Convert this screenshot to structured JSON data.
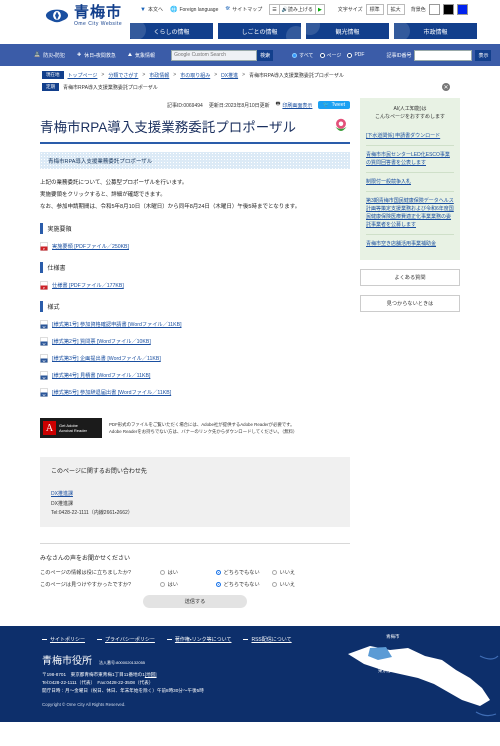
{
  "header": {
    "logo_jp": "青梅市",
    "logo_en": "Ome City Website",
    "utils": [
      {
        "label": "本文へ",
        "icon": "caret-down-icon"
      },
      {
        "label": "Foreign language",
        "icon": "globe-icon"
      },
      {
        "label": "サイトマップ",
        "icon": "sitemap-icon"
      }
    ],
    "speech": {
      "menu_icon": "list-icon",
      "read_label": "読み上げる",
      "play_icon": "play-icon"
    },
    "textsize": {
      "label": "文字サイズ",
      "standard": "標準",
      "large": "拡大"
    },
    "color": {
      "label": "背景色",
      "options": [
        "white",
        "black",
        "blue"
      ]
    },
    "nav": [
      {
        "label": "くらしの情報"
      },
      {
        "label": "しごとの情報"
      },
      {
        "label": "観光情報"
      },
      {
        "label": "市政情報"
      }
    ]
  },
  "subnav": {
    "quick": [
      {
        "label": "防災・防犯",
        "icon": "tower-icon"
      },
      {
        "label": "休日・夜間救急",
        "icon": "hospital-icon"
      },
      {
        "label": "気象情報",
        "icon": "weather-icon"
      }
    ],
    "search_placeholder": "Google Custom Search",
    "search_button": "検索",
    "radios": [
      {
        "label": "すべて",
        "selected": true
      },
      {
        "label": "ページ",
        "selected": false
      },
      {
        "label": "PDF",
        "selected": false
      }
    ],
    "article_id_label": "記事ID番号",
    "article_id_value": "",
    "article_button": "表示"
  },
  "breadcrumb": {
    "current_tag": "現在地",
    "items": [
      "トップページ",
      "分類でさがす",
      "市政情報",
      "市の取り組み",
      "DX推進",
      "青梅市RPA導入支援業務委託プロポーザル"
    ],
    "fixed_tag": "定期",
    "fixed_text": "青梅市RPA導入支援業務委託プロポーザル"
  },
  "article": {
    "article_id": "記事ID:0069494",
    "updated": "更新日:2023年8月10日更新",
    "print_link": "印刷画面表示",
    "tweet_label": "Tweet",
    "title": "青梅市RPA導入支援業務委託プロポーザル",
    "subject_bar": "青梅市RPA導入支援業務委託プロポーザル",
    "paragraphs": [
      "上記の業務委託について、公募型プロポーザルを行います。",
      "実施要領をクリックすると、詳細が確認できます。",
      "なお、参加申請期間は、令和5年8月10日（木曜日）から同年8月24日（木曜日）午後5時までとなります。"
    ],
    "sections": [
      {
        "heading": "実施要領",
        "files": [
          {
            "label": "実施要領 [PDFファイル／250KB]",
            "type": "pdf"
          }
        ]
      },
      {
        "heading": "仕様書",
        "files": [
          {
            "label": "仕様書 [PDFファイル／177KB]",
            "type": "pdf"
          }
        ]
      },
      {
        "heading": "様式",
        "files": [
          {
            "label": "[様式第1号] 参加資格確認申請書 [Wordファイル／11KB]",
            "type": "word"
          },
          {
            "label": "[様式第2号] 質問票 [Wordファイル／10KB]",
            "type": "word"
          },
          {
            "label": "[様式第3号] 企画提出書 [Wordファイル／11KB]",
            "type": "word"
          },
          {
            "label": "[様式第4号] 見積書 [Wordファイル／11KB]",
            "type": "word"
          },
          {
            "label": "[様式第5号] 参加辞退届出書 [Wordファイル／11KB]",
            "type": "word"
          }
        ]
      }
    ],
    "adobe": {
      "brand_small": "Get Adobe",
      "brand_main": "Acrobat Reader",
      "note_line1": "PDF形式のファイルをご覧いただく場合には、Adobe社が提供するAdobe Readerが必要です。",
      "note_line2": "Adobe Readerをお持ちでない方は、バナーのリンク先からダウンロードしてください。（無料）"
    }
  },
  "contact": {
    "heading": "このページに関するお問い合わせ先",
    "dept_link": "DX推進課",
    "dept_name": "DX推進課",
    "tel": "Tel:0428-22-1111（内線2661・2662）"
  },
  "survey": {
    "heading": "みなさんの声をお聞かせください",
    "questions": [
      {
        "text": "このページの情報は役に立ちましたか?",
        "options": [
          {
            "label": "はい",
            "selected": false
          },
          {
            "label": "どちらでもない",
            "selected": true
          },
          {
            "label": "いいえ",
            "selected": false
          }
        ]
      },
      {
        "text": "このページは見つけやすかったですか?",
        "options": [
          {
            "label": "はい",
            "selected": false
          },
          {
            "label": "どちらでもない",
            "selected": true
          },
          {
            "label": "いいえ",
            "selected": false
          }
        ]
      }
    ],
    "submit": "送信する"
  },
  "sidebar": {
    "ai_heading_line1": "AI(人工知能)は",
    "ai_heading_line2": "こんなページをおすすめします",
    "ai_links": [
      "[下水道関係] 申請書ダウンロード",
      "青梅市市民センターLED化ESCO事業の質問回答書を公表します",
      "制限付一般競争入札",
      "第3期青梅市国民健康保険データヘルス計画等策定支援業務および令和6年度国民健康保険医療費適正化事業業務の委託事業者を公募します",
      "青梅市空き店舗活用事業補助金"
    ],
    "buttons": [
      "よくある質問",
      "見つからないときは"
    ]
  },
  "footer": {
    "links": [
      "サイトポリシー",
      "プライバシーポリシー",
      "著作権・リンク等について",
      "RSS配信について"
    ],
    "office_name": "青梅市役所",
    "corp_number": "法人番号:8000020132055",
    "postal": "〒198-8701　東京都青梅市東青梅1丁目11番地の1",
    "map_link": "[地図]",
    "tel_fax": "Tel:0428-22-1111（代表）　Fax:0428-22-3508（代表）",
    "hours": "開庁日時：月～金曜日（祝日、休日、年末年始を除く）午前8時30分～午後5時",
    "copyright": "Copyright © Ome City All Rights Reserved.",
    "map_labels": {
      "city": "青梅市",
      "pref": "東京都"
    }
  }
}
